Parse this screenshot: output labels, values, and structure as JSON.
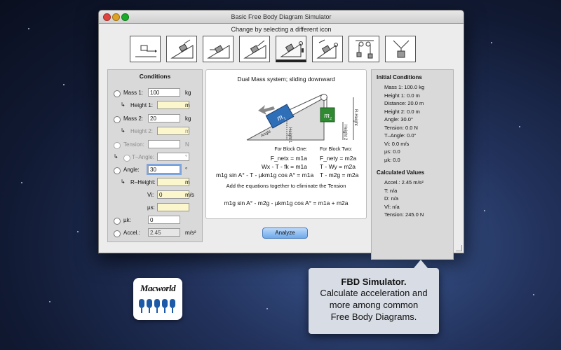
{
  "window": {
    "title": "Basic Free Body Diagram Simulator",
    "subtitle": "Change by selecting a different icon"
  },
  "toolbar": {
    "icons": [
      "flat-push-icon",
      "incline-slide-icon",
      "incline-push-icon",
      "incline-pull-icon",
      "dual-mass-incline-icon",
      "incline-pulley-icon",
      "atwood-machine-icon",
      "hanging-mass-icon"
    ],
    "active_index": 4
  },
  "conditions": {
    "title": "Conditions",
    "rows": [
      {
        "label": "Mass 1:",
        "value": "100",
        "unit": "kg"
      },
      {
        "label": "Height 1:",
        "value": "",
        "unit": "m"
      },
      {
        "label": "Mass 2:",
        "value": "20",
        "unit": "kg"
      },
      {
        "label": "Height 2:",
        "value": "",
        "unit": "m"
      },
      {
        "label": "Tension:",
        "value": "",
        "unit": "N"
      },
      {
        "label": "T–Angle:",
        "value": "",
        "unit": "°"
      },
      {
        "label": "Angle:",
        "value": "30",
        "unit": "°"
      },
      {
        "label": "R–Height:",
        "value": "",
        "unit": "m"
      },
      {
        "label": "Vi:",
        "value": "0",
        "unit": "m/s"
      },
      {
        "label": "µs:",
        "value": "",
        "unit": ""
      },
      {
        "label": "µk:",
        "value": "0",
        "unit": ""
      },
      {
        "label": "Accel.:",
        "value": "2.45",
        "unit": "m/s²"
      }
    ]
  },
  "diagram": {
    "title": "Dual Mass system; sliding downward",
    "m1_label": "m",
    "m1_sub": "1",
    "m2_label": "m",
    "m2_sub": "2",
    "angle_label": "Angle",
    "height1_label": "Height 1",
    "height2_label": "Height 2",
    "rheight_label": "R-Height",
    "block_one_heading": "For Block One:",
    "block_two_heading": "For Block Two:",
    "block_one_eqs": [
      "F_netx = m1a",
      "Wx - T - fk = m1a",
      "m1g sin A° - T - µkm1g cos A° = m1a"
    ],
    "block_two_eqs": [
      "F_nety = m2a",
      "T - Wy = m2a",
      "T - m2g = m2a"
    ],
    "note": "Add the equations together to eliminate the Tension",
    "final_eq": "m1g sin A° - m2g - µkm1g cos A° = m1a + m2a"
  },
  "analyze_label": "Analyze",
  "initial_conditions": {
    "title": "Initial Conditions",
    "items": [
      "Mass 1: 100.0 kg",
      "Height 1: 0.0 m",
      "Distance: 20.0 m",
      "Height 2: 0.0 m",
      "Angle: 30.0°",
      "Tension: 0.0 N",
      "T–Angle: 0.0°",
      "Vi: 0.0 m/s",
      "µs: 0.0",
      "µk: 0.0"
    ]
  },
  "calculated_values": {
    "title": "Calculated Values",
    "items": [
      "Accel.: 2.45 m/s²",
      "T: n/a",
      "D: n/a",
      "Vf: n/a",
      "Tension: 245.0 N"
    ]
  },
  "badge": {
    "text": "Macworld",
    "rating_mice": 5
  },
  "callout": {
    "heading": "FBD Simulator.",
    "lines": [
      "Calculate acceleration and",
      "more among common",
      "Free Body Diagrams."
    ]
  },
  "colors": {
    "m1_block": "#2f6fb8",
    "m2_block": "#2f8a32",
    "badge_blue": "#1d5ba8"
  }
}
